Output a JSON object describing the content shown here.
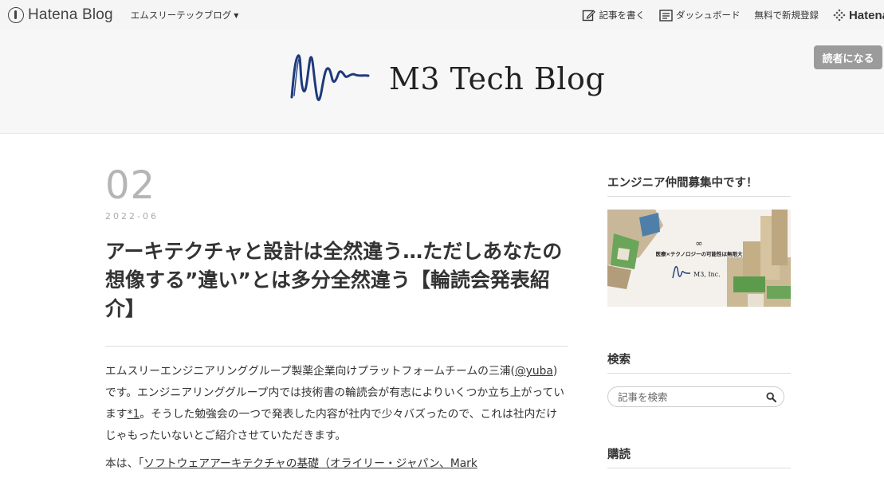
{
  "globalbar": {
    "logo_text": "Hatena Blog",
    "blog_select": "エムスリーテックブログ",
    "write_label": "記事を書く",
    "dashboard_label": "ダッシュボード",
    "signup_label": "無料で新規登録",
    "hatena_label": "Hatena"
  },
  "header": {
    "title": "M3 Tech Blog",
    "subscribe_label": "読者になる"
  },
  "entry": {
    "date_day": "02",
    "date_ym": "2022-06",
    "title": "アーキテクチャと設計は全然違う…ただしあなたの想像する”違い”とは多分全然違う【輪読会発表紹介】",
    "p1_a": "エムスリーエンジニアリンググループ製薬企業向けプラットフォームチームの三浦(",
    "p1_link": "@yuba",
    "p1_b": ")です。エンジニアリンググループ内では技術書の輪読会が有志によりいくつか立ち上がっています",
    "p1_footnote": "*1",
    "p1_c": "。そうした勉強会の一つで発表した内容が社内で少々バズったので、これは社内だけじゃもったいないとご紹介させていただきます。",
    "p2_a": "本は、「",
    "p2_link": "ソフトウェアアーキテクチャの基礎（オライリー・ジャパン、Mark"
  },
  "sidebar": {
    "recruit_title": "エンジニア仲間募集中です！",
    "banner_slogan": "医療×テクノロジーの可能性は無限大",
    "banner_company": "M3, Inc.",
    "search_title": "検索",
    "search_placeholder": "記事を検索",
    "subscribe_title": "購読"
  },
  "colors": {
    "logo_blue": "#1f3a7a",
    "subscribe_bg": "#9b9b9b",
    "date_gray": "#b5b5b5"
  },
  "icons": {
    "search": "search-icon",
    "edit": "pencil-icon",
    "dashboard": "dashboard-icon",
    "hatena": "hatena-dots-icon"
  }
}
